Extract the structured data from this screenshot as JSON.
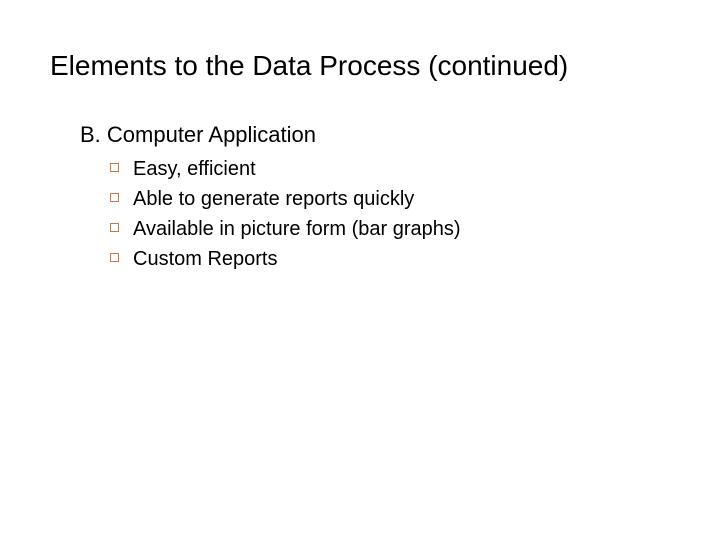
{
  "title": "Elements to the Data Process (continued)",
  "section": {
    "heading": "B. Computer Application",
    "items": [
      "Easy, efficient",
      "Able to generate reports quickly",
      "Available in picture form (bar graphs)",
      "Custom Reports"
    ]
  }
}
